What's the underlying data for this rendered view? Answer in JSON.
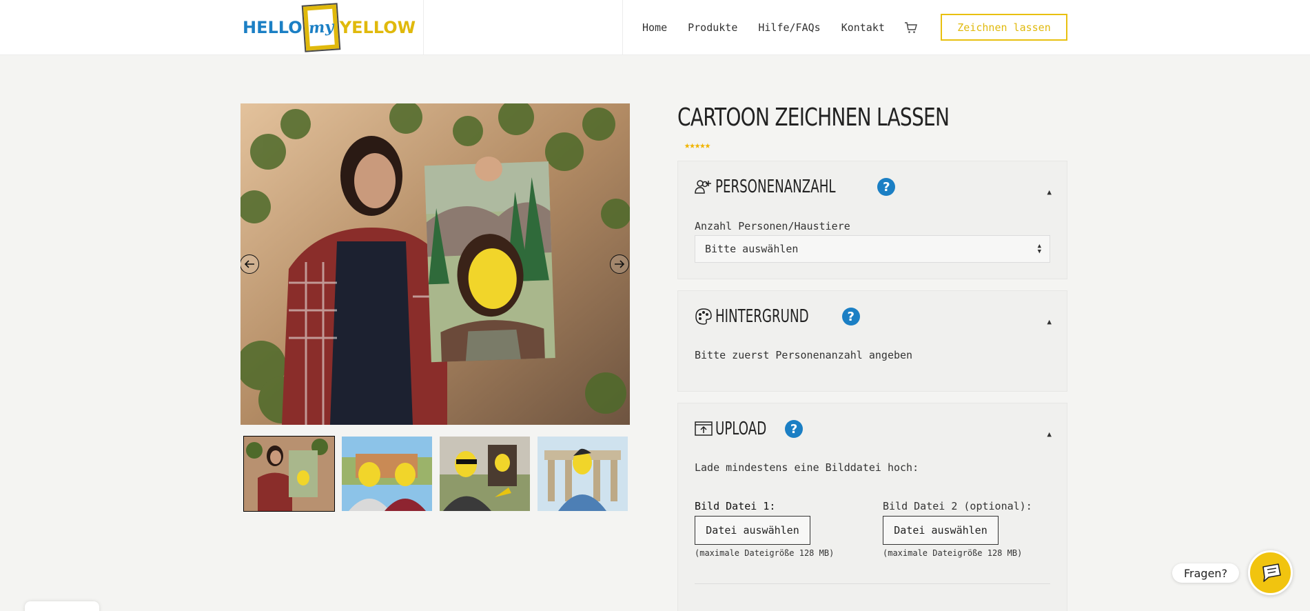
{
  "header": {
    "logo": {
      "hello": "HELLO",
      "my": "my",
      "yellow": "YELLOW"
    },
    "nav": [
      {
        "label": "Home"
      },
      {
        "label": "Produkte"
      },
      {
        "label": "Hilfe/FAQs"
      },
      {
        "label": "Kontakt"
      }
    ],
    "cart_icon": "shopping-cart-icon",
    "cta_label": "Zeichnen lassen"
  },
  "gallery": {
    "prev_icon": "arrow-left-circle-icon",
    "next_icon": "arrow-right-circle-icon",
    "thumbnails": [
      "thumb-1",
      "thumb-2",
      "thumb-3",
      "thumb-4"
    ],
    "active_thumbnail": 1
  },
  "product": {
    "title": "Cartoon zeichnen lassen",
    "rating_stars": "★★★★★",
    "rating": 5
  },
  "sections": {
    "persons": {
      "icon": "people-add-icon",
      "title": "Personenanzahl",
      "help": "?",
      "field_label": "Anzahl Personen/Haustiere",
      "select_value": "Bitte auswählen"
    },
    "background": {
      "icon": "palette-icon",
      "title": "Hintergrund",
      "help": "?",
      "text": "Bitte zuerst Personenanzahl angeben"
    },
    "upload": {
      "icon": "upload-image-icon",
      "title": "Upload",
      "help": "?",
      "intro": "Lade mindestens eine Bilddatei hoch:",
      "file1_label": "Bild Datei 1:",
      "file2_label": "Bild Datei 2 (optional):",
      "button_label": "Datei auswählen",
      "max_note": "(maximale Dateigröße 128 MB)"
    }
  },
  "chat": {
    "label": "Fragen?",
    "icon": "chat-icon"
  }
}
